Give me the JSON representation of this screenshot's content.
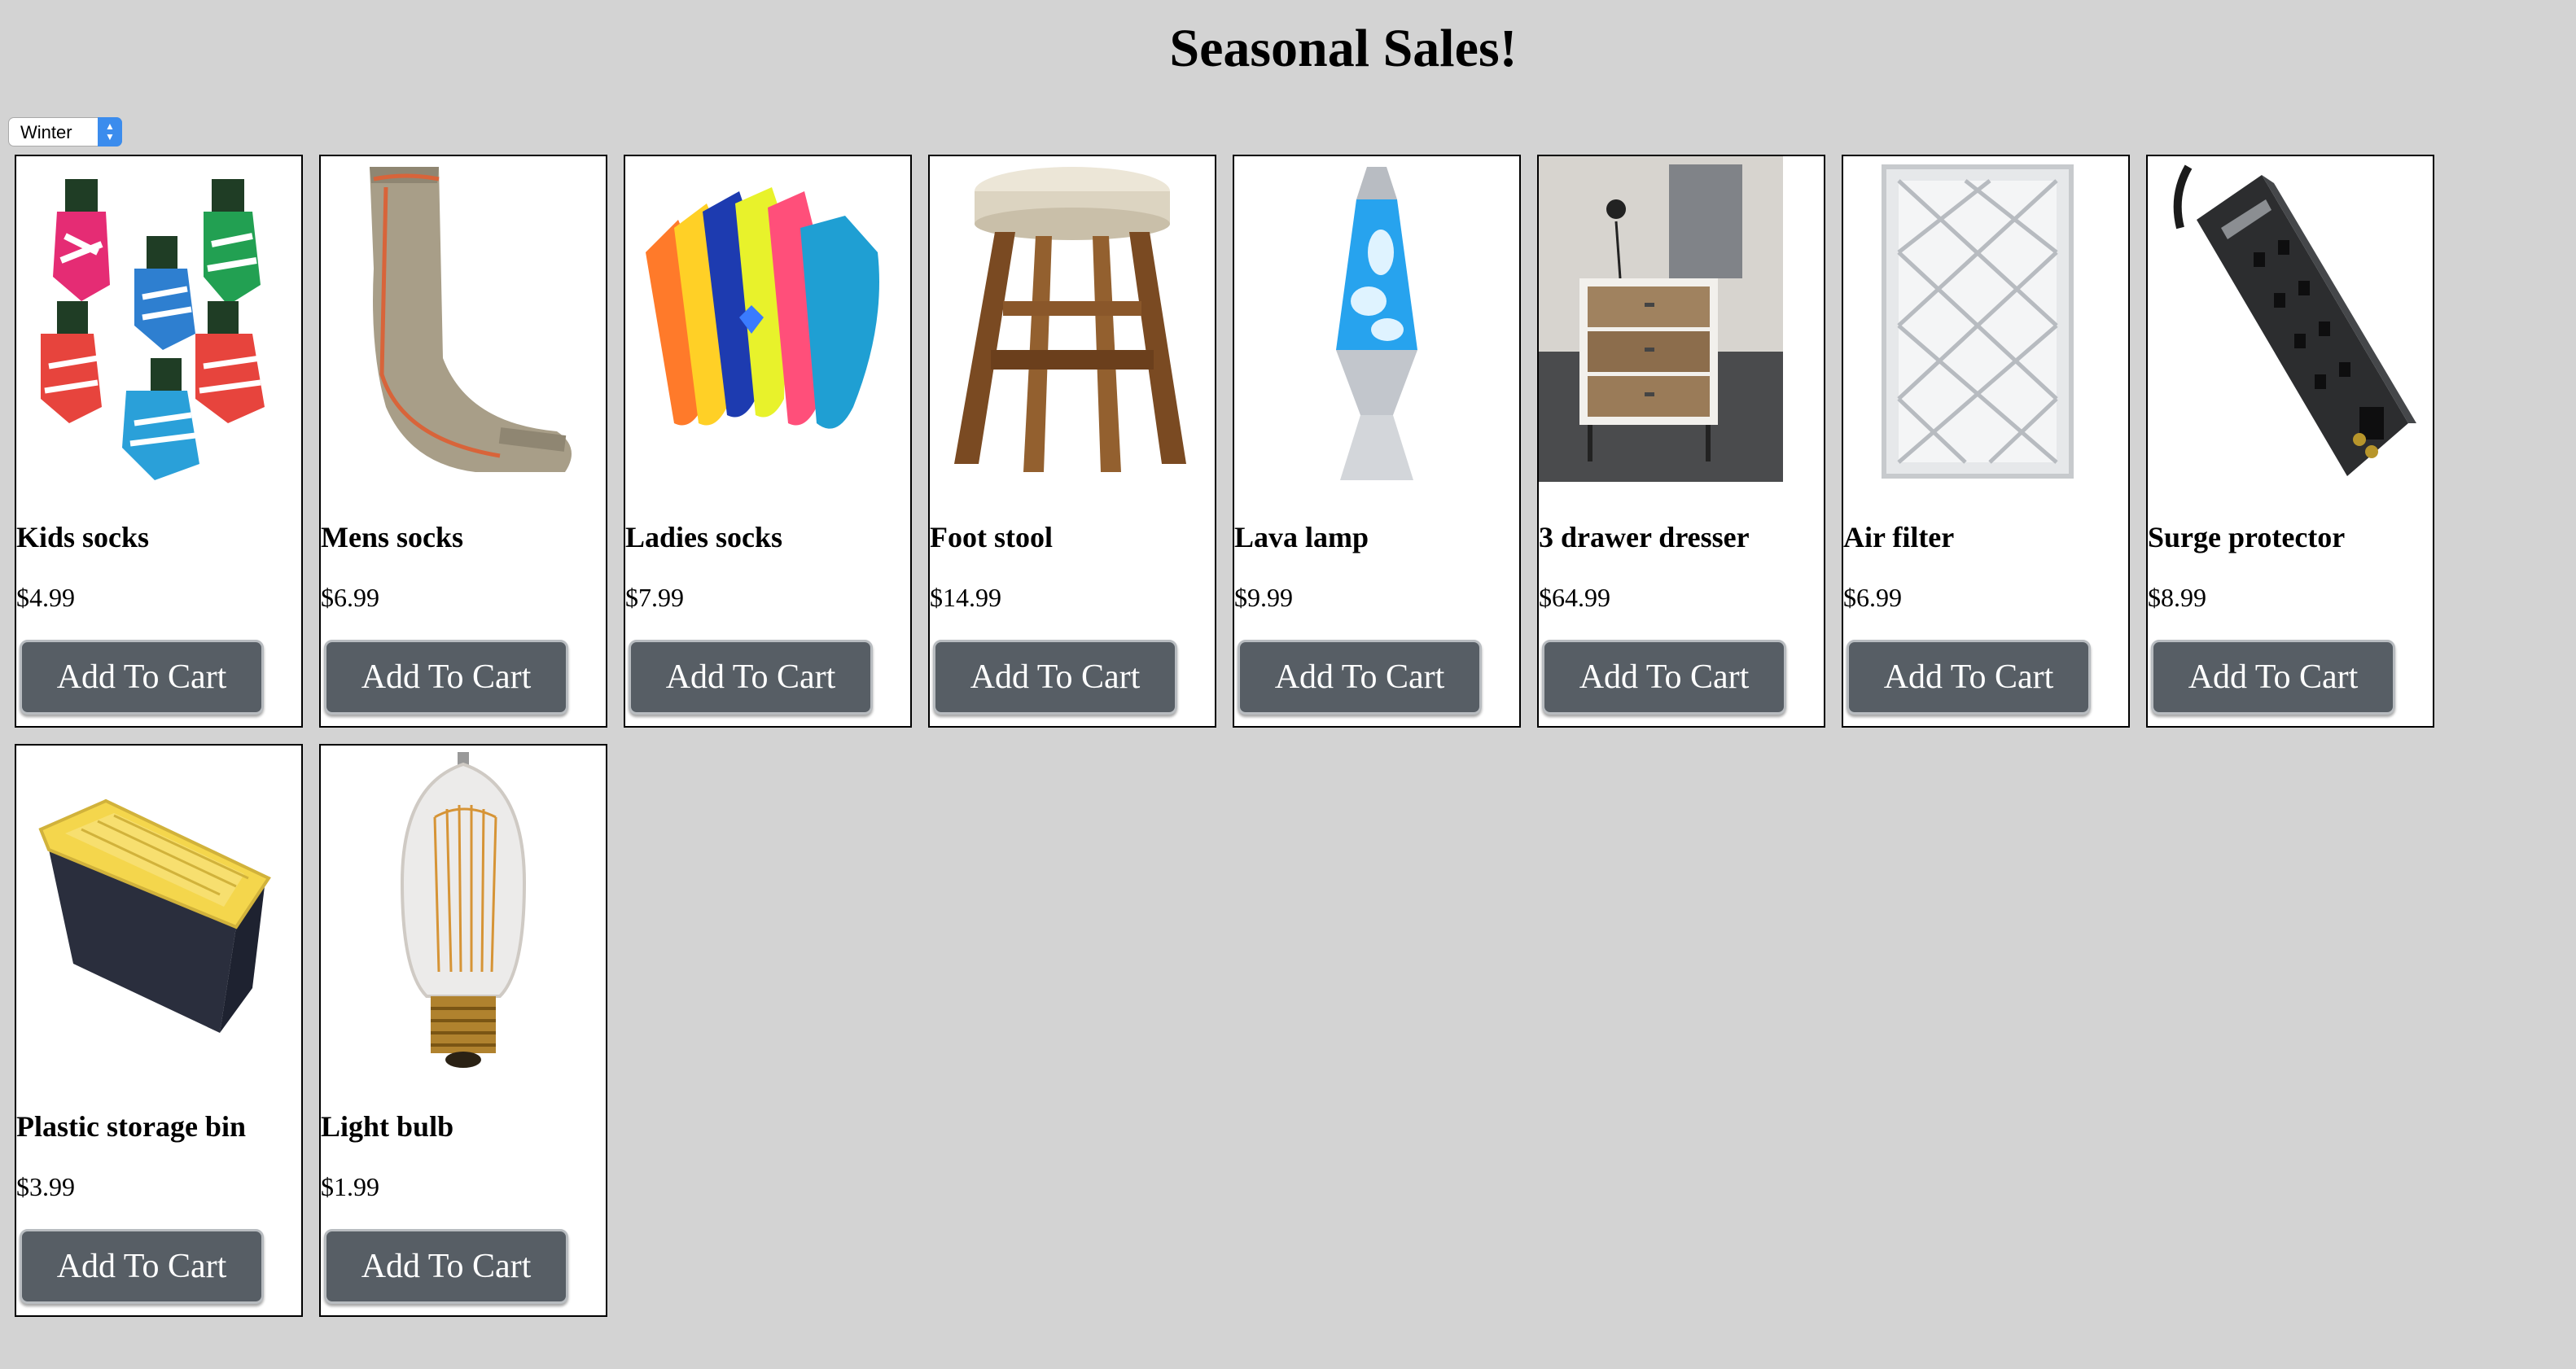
{
  "page": {
    "title": "Seasonal Sales!"
  },
  "season_select": {
    "selected": "Winter"
  },
  "button_label": "Add To Cart",
  "products": [
    {
      "name": "Kids socks",
      "price": "$4.99",
      "icon": "kids-socks-icon"
    },
    {
      "name": "Mens socks",
      "price": "$6.99",
      "icon": "mens-sock-icon"
    },
    {
      "name": "Ladies socks",
      "price": "$7.99",
      "icon": "ladies-socks-icon"
    },
    {
      "name": "Foot stool",
      "price": "$14.99",
      "icon": "stool-icon"
    },
    {
      "name": "Lava lamp",
      "price": "$9.99",
      "icon": "lava-lamp-icon"
    },
    {
      "name": "3 drawer dresser",
      "price": "$64.99",
      "icon": "dresser-icon"
    },
    {
      "name": "Air filter",
      "price": "$6.99",
      "icon": "air-filter-icon"
    },
    {
      "name": "Surge protector",
      "price": "$8.99",
      "icon": "power-strip-icon"
    },
    {
      "name": "Plastic storage bin",
      "price": "$3.99",
      "icon": "storage-bin-icon"
    },
    {
      "name": "Light bulb",
      "price": "$1.99",
      "icon": "light-bulb-icon"
    }
  ]
}
